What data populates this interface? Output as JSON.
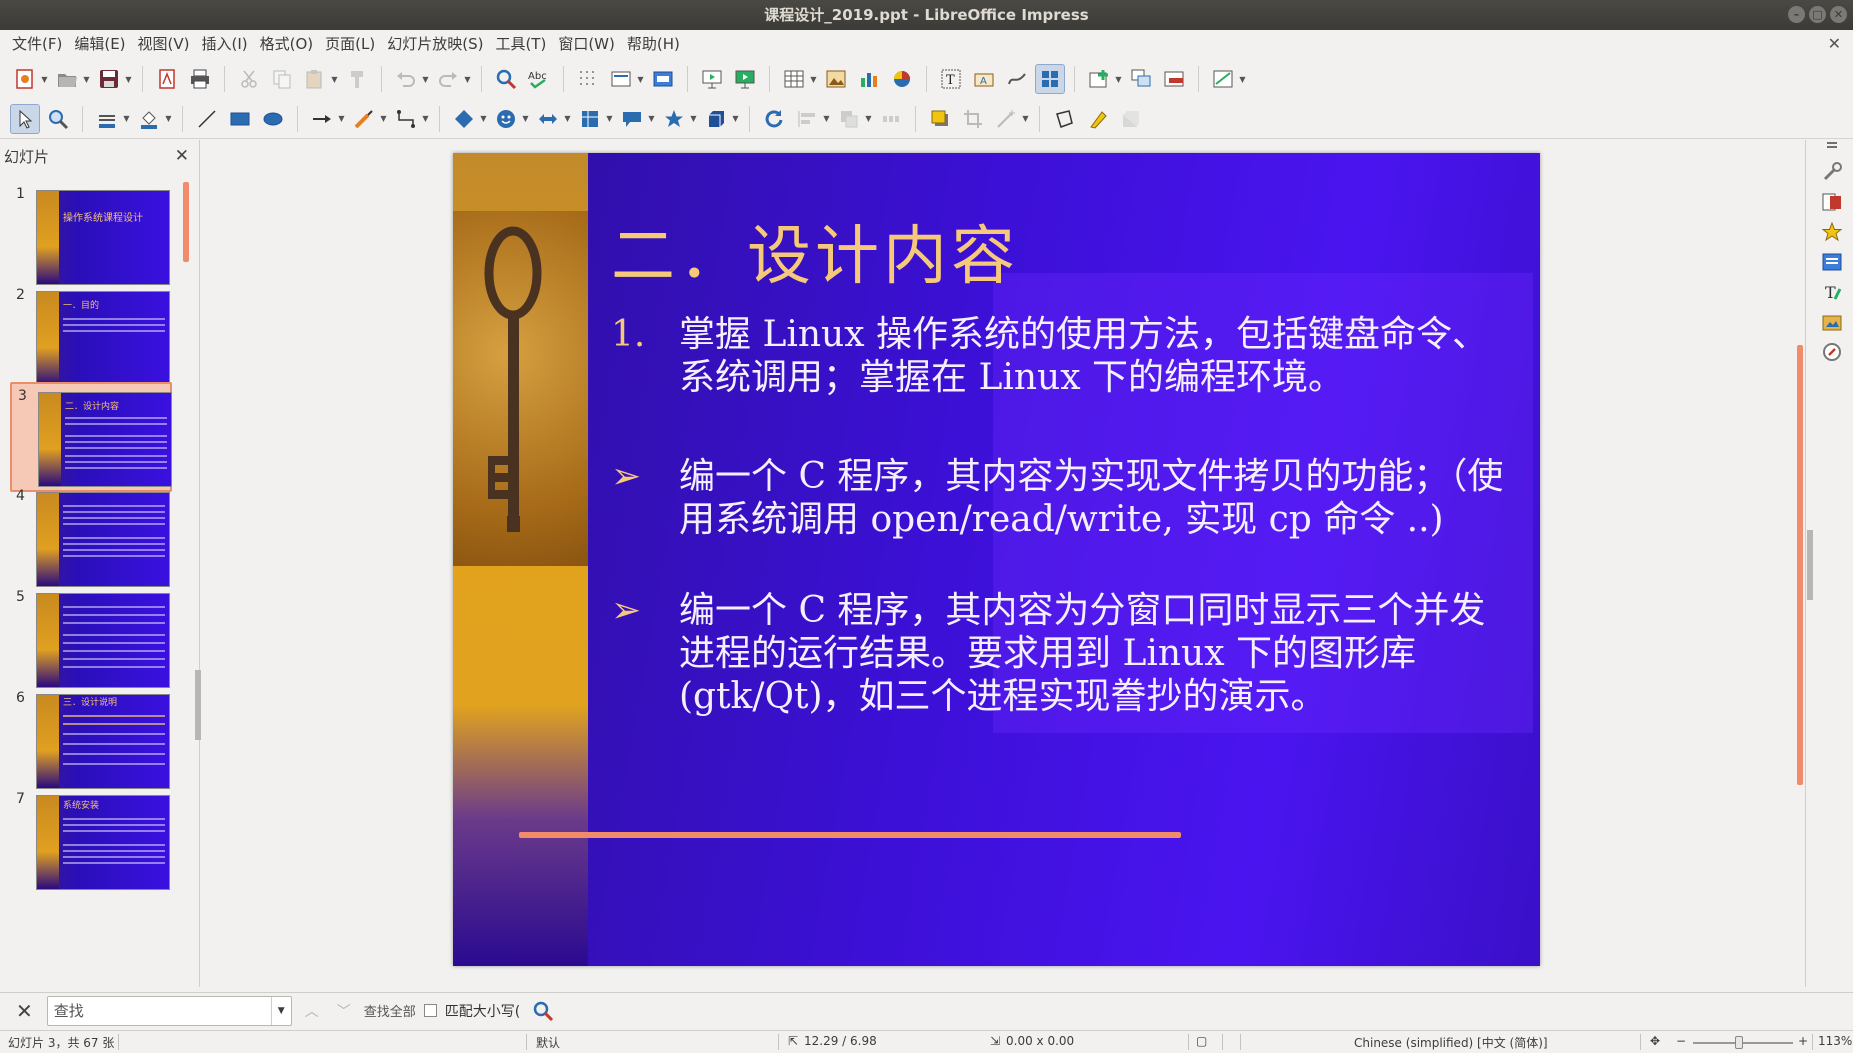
{
  "window": {
    "title": "课程设计_2019.ppt - LibreOffice Impress"
  },
  "menu": [
    "文件(F)",
    "编辑(E)",
    "视图(V)",
    "插入(I)",
    "格式(O)",
    "页面(L)",
    "幻灯片放映(S)",
    "工具(T)",
    "窗口(W)",
    "帮助(H)"
  ],
  "slides_pane": {
    "title": "幻灯片",
    "slides": [
      {
        "num": "1",
        "title": "操作系统课程设计"
      },
      {
        "num": "2",
        "title": "一．目的"
      },
      {
        "num": "3",
        "title": "二．设计内容"
      },
      {
        "num": "4",
        "title": ""
      },
      {
        "num": "5",
        "title": ""
      },
      {
        "num": "6",
        "title": "三．设计说明"
      },
      {
        "num": "7",
        "title": "系统安装"
      }
    ]
  },
  "slide": {
    "title": "二．设计内容",
    "bullets": [
      {
        "marker": "1.",
        "text": "掌握 Linux 操作系统的使用方法，包括键盘命令、系统调用；掌握在 Linux 下的编程环境。"
      },
      {
        "marker": "➢",
        "text": "编一个 C 程序，其内容为实现文件拷贝的功能；（使用系统调用 open/read/write, 实现 cp 命令 ..)"
      },
      {
        "marker": "➢",
        "text": "编一个 C 程序，其内容为分窗口同时显示三个并发进程的运行结果。要求用到 Linux 下的图形库 (gtk/Qt)，如三个进程实现誊抄的演示。"
      }
    ]
  },
  "findbar": {
    "placeholder": "查找",
    "find_all": "查找全部",
    "match_case": "匹配大小写("
  },
  "status": {
    "slide_info": "幻灯片 3，共 67 张",
    "layout": "默认",
    "position": "12.29 / 6.98",
    "size": "0.00 x 0.00",
    "language": "Chinese (simplified) [中文 (简体)]",
    "zoom": "113%"
  },
  "colors": {
    "accent_scroll": "#f08c6a",
    "slide_title": "#f6c97a",
    "slide_bg": "#3c10d6"
  }
}
